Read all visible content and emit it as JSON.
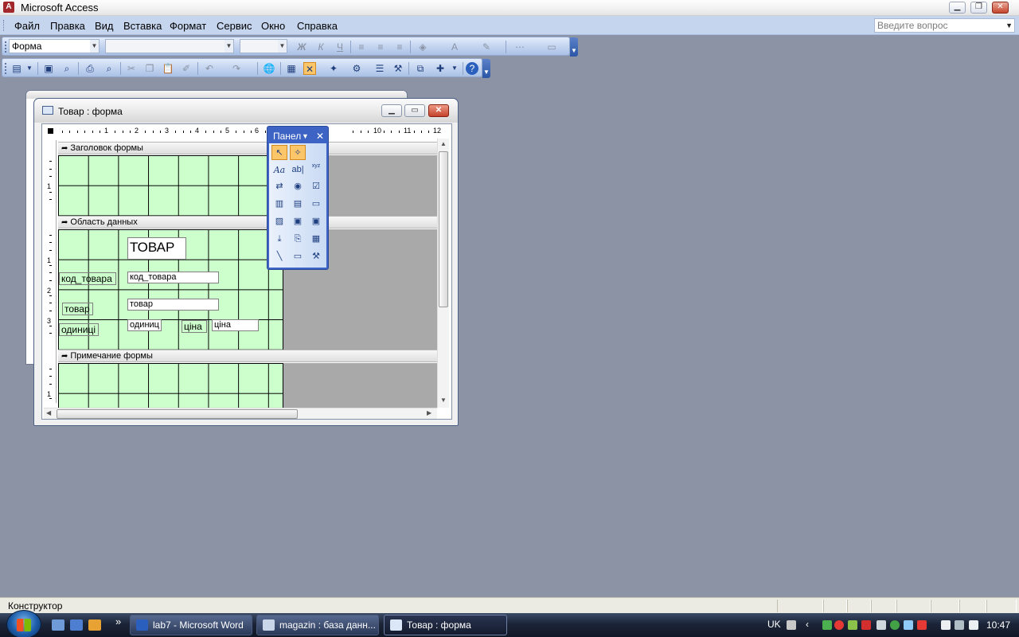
{
  "app": {
    "title": "Microsoft Access",
    "icon_letter": "A"
  },
  "menu": {
    "items": [
      "Файл",
      "Правка",
      "Вид",
      "Вставка",
      "Формат",
      "Сервис",
      "Окно",
      "Справка"
    ],
    "help_placeholder": "Введите вопрос"
  },
  "format_toolbar": {
    "object_combo": "Форма",
    "bold": "Ж",
    "italic": "К",
    "underline": "Ч",
    "font_color": "A"
  },
  "form_window": {
    "title": "Товар : форма",
    "ruler_h": [
      "1",
      "2",
      "3",
      "4",
      "5",
      "6",
      "10",
      "11",
      "12"
    ],
    "ruler_v_header": [
      "1"
    ],
    "ruler_v_data": [
      "1",
      "2",
      "3"
    ],
    "ruler_v_footer": [
      "1"
    ],
    "sections": {
      "header": "Заголовок формы",
      "detail": "Область данных",
      "footer": "Примечание формы"
    },
    "controls": {
      "title_label": "ТОВАР",
      "kod_label": "код_товара",
      "kod_field": "код_товара",
      "tovar_label": "товар",
      "tovar_field": "товар",
      "odinici_label": "одиниці",
      "odinic_field": "одиниц",
      "cina_label": "ціна",
      "cina_field": "ціна"
    }
  },
  "toolbox": {
    "title": "Панел",
    "label_tool": "Aa",
    "textbox_tool": "ab|",
    "xyz": "xyz"
  },
  "status": {
    "text": "Конструктор"
  },
  "taskbar": {
    "tasks": [
      "lab7 - Microsoft Word",
      "magazin : база данн...",
      "Товар : форма"
    ],
    "lang": "UK",
    "clock": "10:47",
    "more": "»"
  },
  "colors": {
    "grid_bg": "#ccffcc",
    "toolbox_bg": "#3d64c4",
    "desktop": "#8c93a5",
    "accent_active_tool": "#fbc66a"
  }
}
